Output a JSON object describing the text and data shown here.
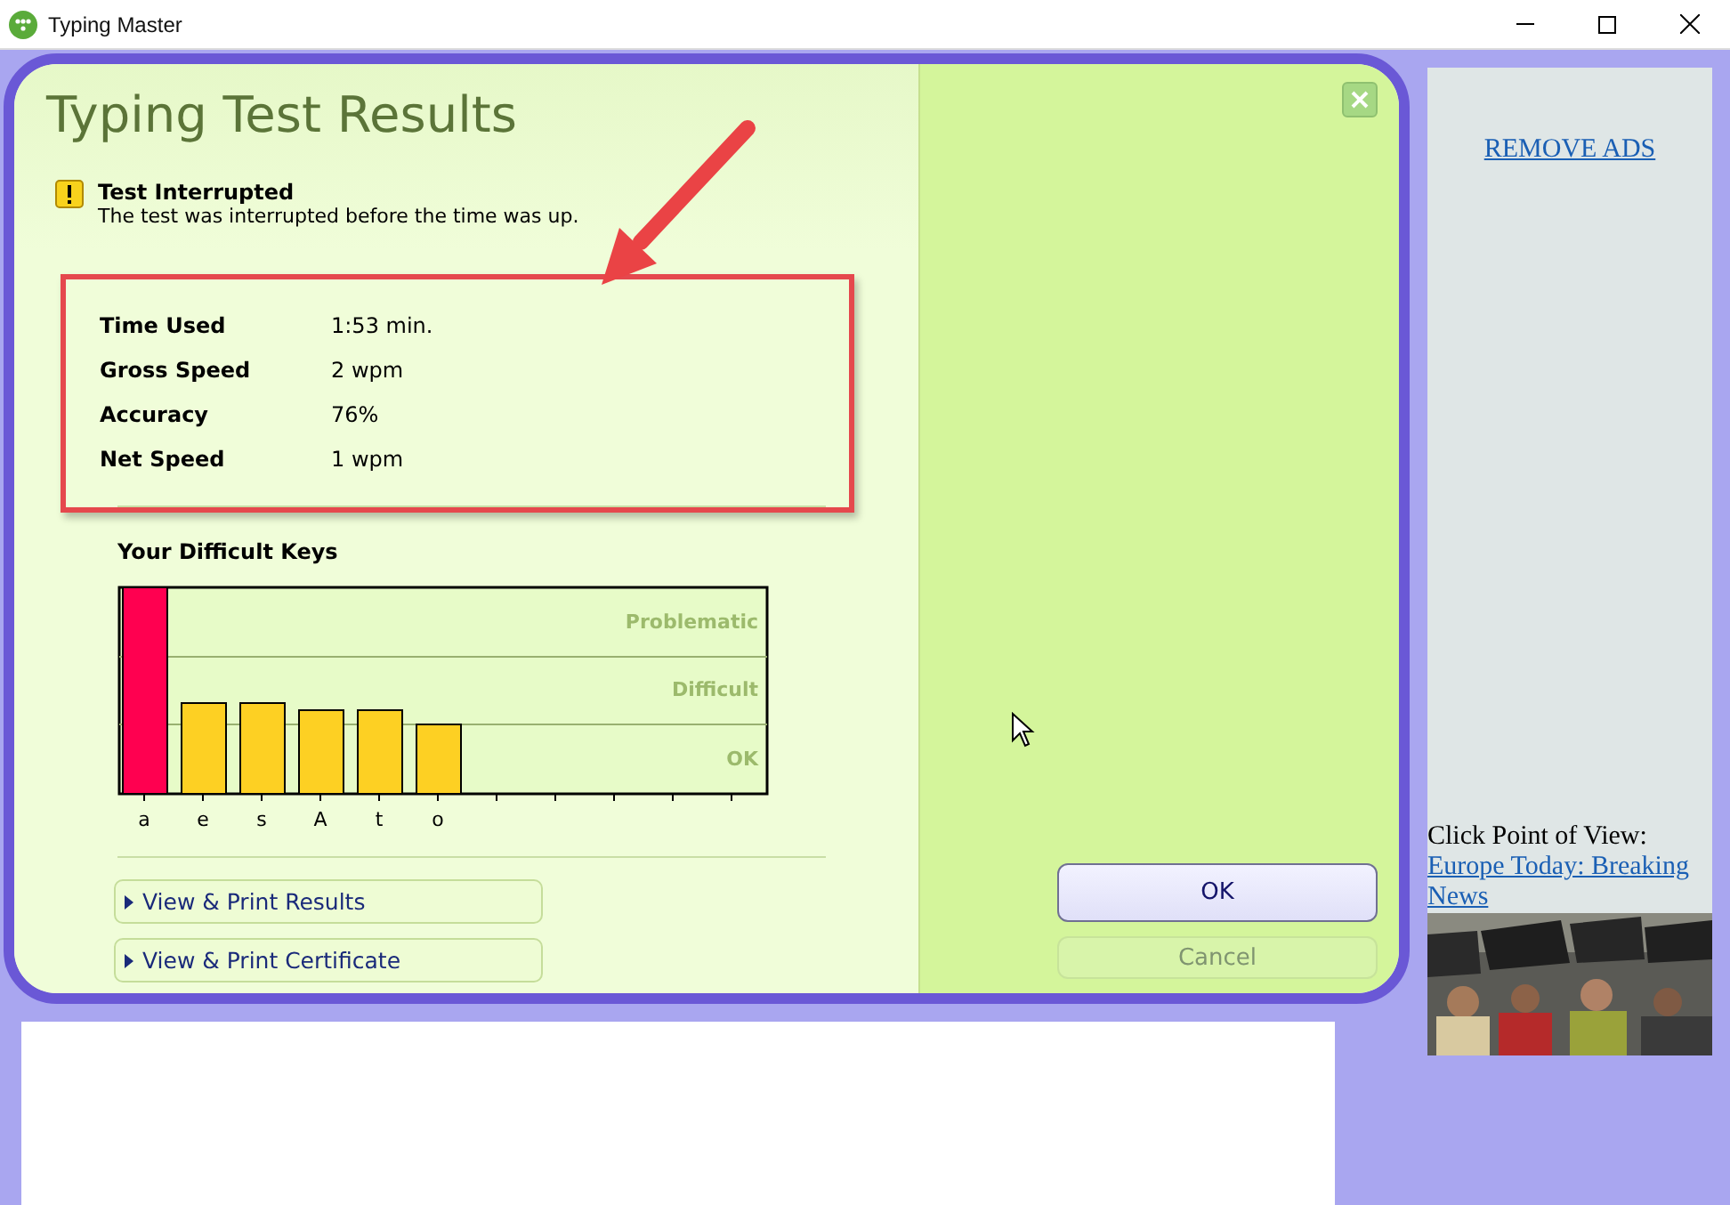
{
  "window": {
    "title": "Typing Master"
  },
  "dialog": {
    "title": "Typing Test Results",
    "notice": {
      "title": "Test Interrupted",
      "message": "The test was interrupted before the time was up."
    },
    "stats": [
      {
        "label": "Time Used",
        "value": "1:53 min."
      },
      {
        "label": "Gross Speed",
        "value": "2 wpm"
      },
      {
        "label": "Accuracy",
        "value": "76%"
      },
      {
        "label": "Net Speed",
        "value": "1 wpm"
      }
    ],
    "difficult_keys": {
      "title": "Your Difficult Keys",
      "zones": [
        "Problematic",
        "Difficult",
        "OK"
      ],
      "keys": [
        {
          "label": "a",
          "color": "#ff0050"
        },
        {
          "label": "e",
          "color": "#fdd023"
        },
        {
          "label": "s",
          "color": "#fdd023"
        },
        {
          "label": "A",
          "color": "#fdd023"
        },
        {
          "label": "t",
          "color": "#fdd023"
        },
        {
          "label": "o",
          "color": "#fdd023"
        }
      ]
    },
    "links": [
      "View & Print Results",
      "View & Print Certificate"
    ],
    "buttons": [
      {
        "label": "OK",
        "disabled": false
      },
      {
        "label": "Cancel",
        "disabled": true
      }
    ]
  },
  "ad_panel": {
    "remove_ads": "REMOVE ADS",
    "caption": "Click Point of View:",
    "link": "Europe Today: Breaking News"
  }
}
